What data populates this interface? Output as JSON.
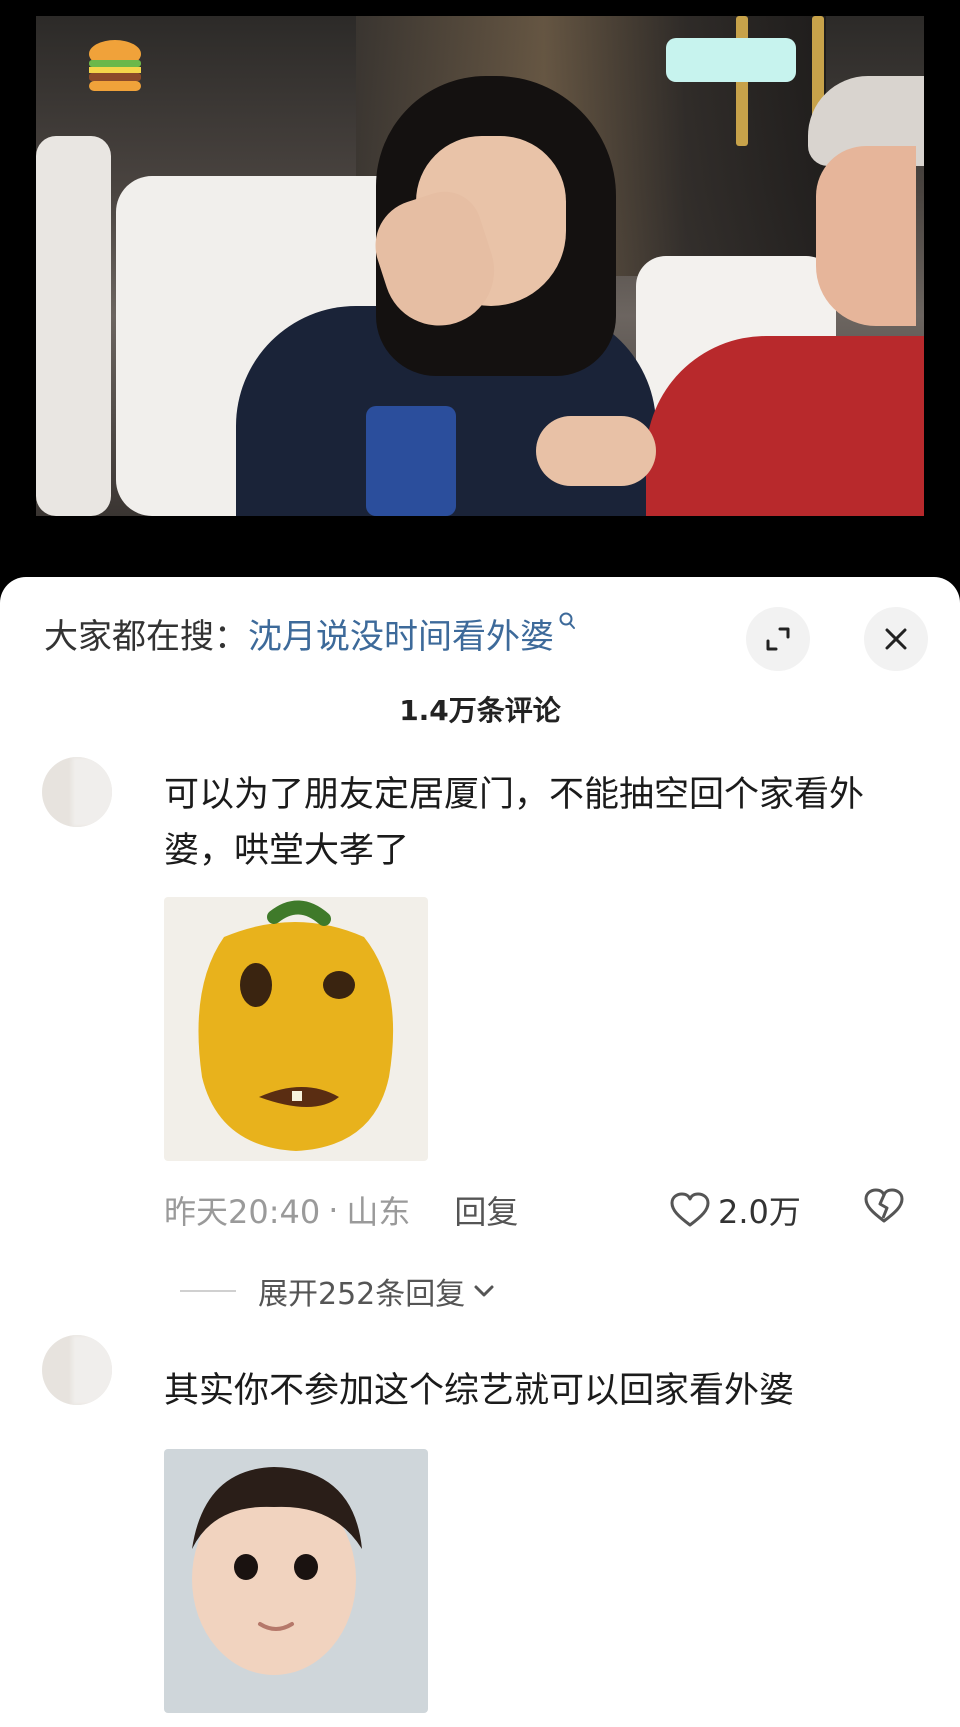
{
  "search": {
    "prefix": "大家都在搜：",
    "term": "沈月说没时间看外婆"
  },
  "comments_header": {
    "count_label": "1.4万条评论"
  },
  "comments": [
    {
      "text": "可以为了朋友定居厦门，不能抽空回个家看外婆，哄堂大孝了",
      "time": "昨天20:40",
      "separator": "·",
      "location": "山东",
      "reply_label": "回复",
      "likes": "2.0万",
      "expand_label": "展开252条回复"
    },
    {
      "name": "",
      "text": "其实你不参加这个综艺就可以回家看外婆"
    }
  ],
  "icons": {
    "search": "search-icon",
    "expand": "expand-icon",
    "close": "close-icon",
    "like": "heart-icon",
    "dislike": "broken-heart-icon",
    "chevron": "chevron-down-icon"
  },
  "colors": {
    "search_term": "#3d6a9a",
    "meme_pepper": "#e8b21c",
    "sweater": "#b8292c"
  }
}
